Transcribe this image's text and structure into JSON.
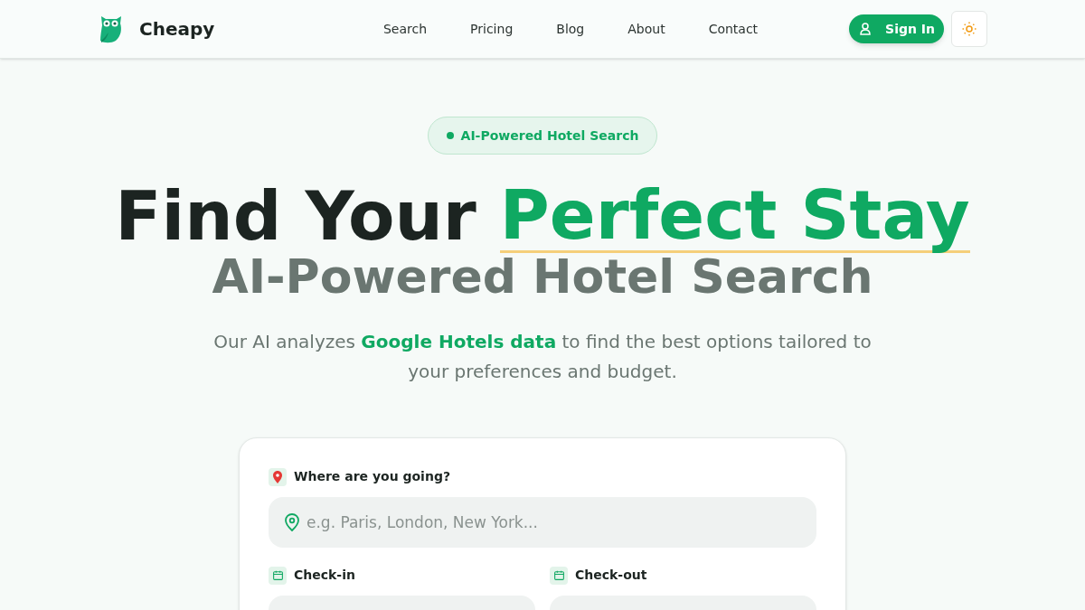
{
  "brand": {
    "name": "Cheapy"
  },
  "nav": [
    {
      "label": "Search"
    },
    {
      "label": "Pricing"
    },
    {
      "label": "Blog"
    },
    {
      "label": "About"
    },
    {
      "label": "Contact"
    }
  ],
  "sign_in": {
    "label": "Sign In"
  },
  "badge": {
    "label": "AI-Powered Hotel Search"
  },
  "headline": {
    "plain": "Find Your",
    "highlight": "Perfect Stay"
  },
  "subheadline": "AI-Powered Hotel Search",
  "description": {
    "before": "Our AI analyzes ",
    "highlight": "Google Hotels data",
    "after": " to find the best options tailored to your preferences and budget."
  },
  "search_form": {
    "destination": {
      "label": "Where are you going?",
      "placeholder": "e.g. Paris, London, New York..."
    },
    "dates": [
      {
        "label": "Check-in"
      },
      {
        "label": "Check-out"
      }
    ]
  }
}
